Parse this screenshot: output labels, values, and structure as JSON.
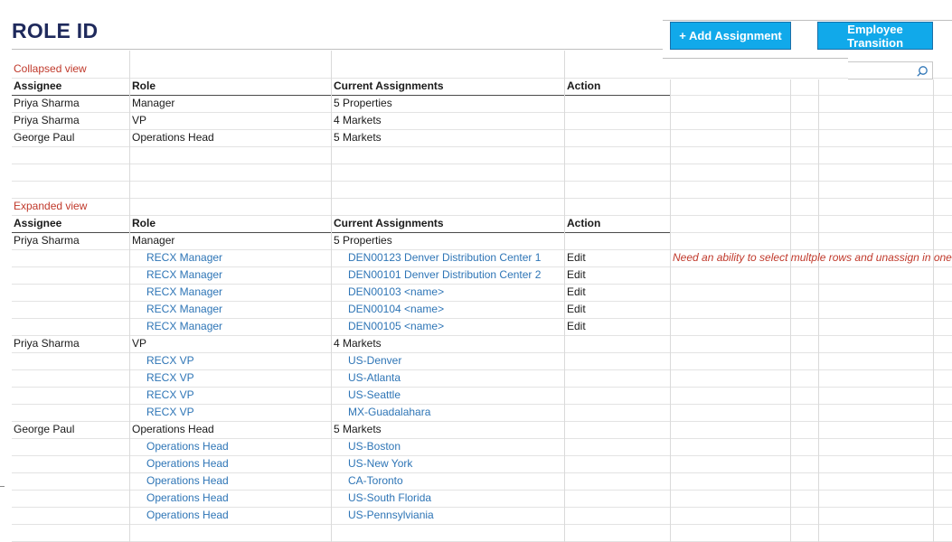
{
  "page": {
    "title": "ROLE ID"
  },
  "toolbar": {
    "add_label": "+ Add Assignment",
    "transition_label": "Employee Transition"
  },
  "collapsed": {
    "label": "Collapsed view",
    "headers": {
      "assignee": "Assignee",
      "role": "Role",
      "assignments": "Current Assignments",
      "action": "Action"
    },
    "rows": [
      {
        "assignee": "Priya Sharma",
        "role": "Manager",
        "assignments": "5 Properties"
      },
      {
        "assignee": "Priya Sharma",
        "role": "VP",
        "assignments": "4 Markets"
      },
      {
        "assignee": "George Paul",
        "role": "Operations Head",
        "assignments": "5 Markets"
      }
    ]
  },
  "expanded": {
    "label": "Expanded view",
    "headers": {
      "assignee": "Assignee",
      "role": "Role",
      "assignments": "Current Assignments",
      "action": "Action"
    },
    "groups": [
      {
        "assignee": "Priya Sharma",
        "role": "Manager",
        "assignments": "5 Properties",
        "items": [
          {
            "role": "RECX Manager",
            "assignment": "DEN00123 Denver Distribution Center 1",
            "action": "Edit"
          },
          {
            "role": "RECX Manager",
            "assignment": "DEN00101 Denver Distribution Center 2",
            "action": "Edit"
          },
          {
            "role": "RECX Manager",
            "assignment": "DEN00103 <name>",
            "action": "Edit"
          },
          {
            "role": "RECX Manager",
            "assignment": "DEN00104 <name>",
            "action": "Edit"
          },
          {
            "role": "RECX Manager",
            "assignment": "DEN00105 <name>",
            "action": "Edit"
          }
        ]
      },
      {
        "assignee": "Priya Sharma",
        "role": "VP",
        "assignments": "4 Markets",
        "items": [
          {
            "role": "RECX VP",
            "assignment": "US-Denver",
            "action": ""
          },
          {
            "role": "RECX VP",
            "assignment": "US-Atlanta",
            "action": ""
          },
          {
            "role": "RECX VP",
            "assignment": "US-Seattle",
            "action": ""
          },
          {
            "role": "RECX VP",
            "assignment": "MX-Guadalahara",
            "action": ""
          }
        ]
      },
      {
        "assignee": "George Paul",
        "role": "Operations Head",
        "assignments": "5 Markets",
        "items": [
          {
            "role": "Operations Head",
            "assignment": "US-Boston",
            "action": ""
          },
          {
            "role": "Operations Head",
            "assignment": "US-New York",
            "action": ""
          },
          {
            "role": "Operations Head",
            "assignment": "CA-Toronto",
            "action": ""
          },
          {
            "role": "Operations Head",
            "assignment": "US-South Florida",
            "action": ""
          },
          {
            "role": "Operations Head",
            "assignment": "US-Pennsylviania",
            "action": ""
          }
        ]
      }
    ]
  },
  "note": "Need an ability to select multple rows and unassign in one"
}
